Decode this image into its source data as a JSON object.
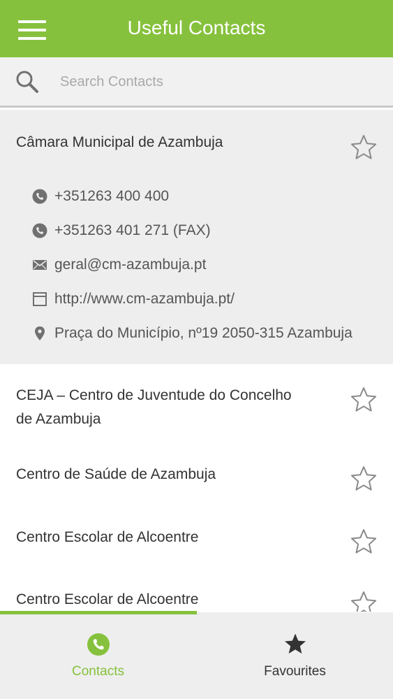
{
  "app": {
    "title": "Useful Contacts"
  },
  "search": {
    "placeholder": "Search Contacts",
    "value": ""
  },
  "contacts": [
    {
      "name": "Câmara Municipal de Azambuja",
      "expanded": true,
      "phone": "+351263 400 400",
      "fax": "+351263 401 271 (FAX)",
      "email": "geral@cm-azambuja.pt",
      "website": "http://www.cm-azambuja.pt/",
      "address": "Praça do Município, nº19 2050-315 Azambuja",
      "favourite": false
    },
    {
      "name_line1": "CEJA – Centro de Juventude do Concelho",
      "name_line2": "de Azambuja",
      "favourite": false
    },
    {
      "name": "Centro de Saúde de Azambuja",
      "favourite": false
    },
    {
      "name": "Centro Escolar de Alcoentre",
      "favourite": false
    },
    {
      "name": "Centro Escolar de Alcoentre",
      "favourite": false
    }
  ],
  "bottom_nav": {
    "contacts_label": "Contacts",
    "favourites_label": "Favourites",
    "active": "contacts"
  },
  "colors": {
    "accent": "#86c13d",
    "icon_gray": "#707070",
    "background_gray": "#eeeeee"
  },
  "icons": {
    "menu": "hamburger-icon",
    "search": "search-icon",
    "star": "star-outline-icon",
    "phone": "phone-icon",
    "email": "envelope-icon",
    "website": "browser-window-icon",
    "address": "location-pin-icon",
    "favourites": "star-filled-icon"
  }
}
